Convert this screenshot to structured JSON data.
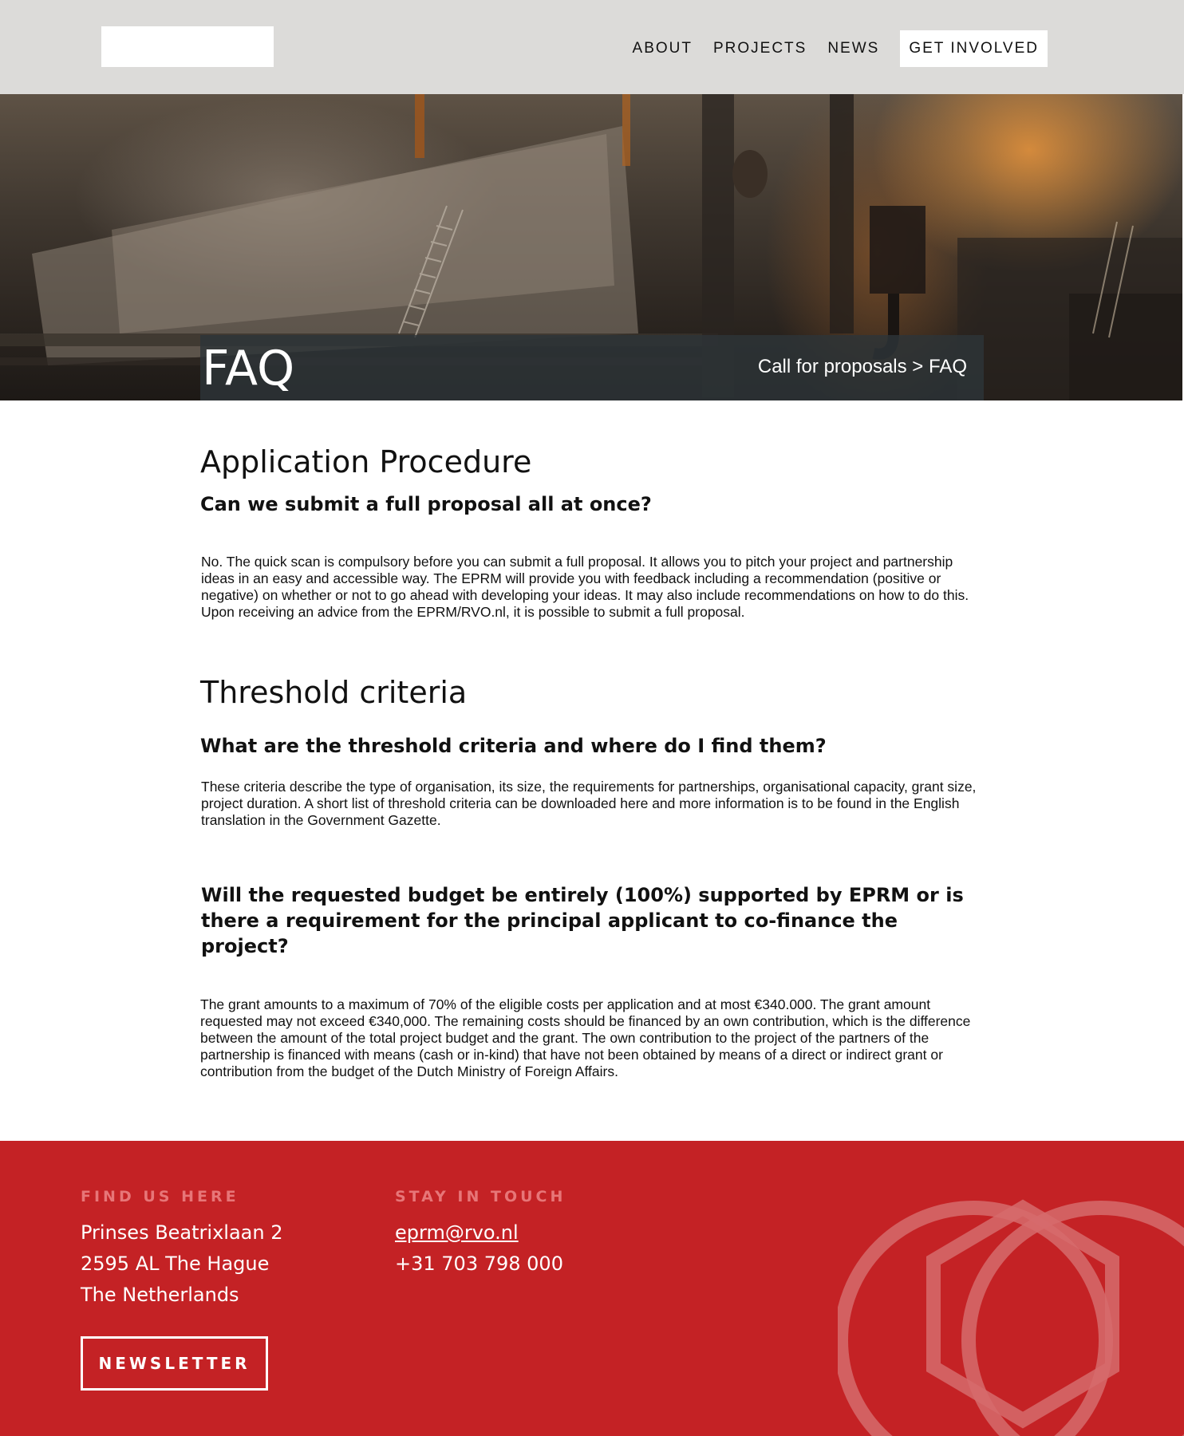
{
  "header": {
    "nav": [
      {
        "label": "ABOUT"
      },
      {
        "label": "PROJECTS"
      },
      {
        "label": "NEWS"
      },
      {
        "label": "GET INVOLVED"
      }
    ]
  },
  "hero": {
    "title": "FAQ",
    "breadcrumb": "Call for proposals > FAQ"
  },
  "sections": [
    {
      "heading": "Application Procedure",
      "question": "Can we submit a full proposal all at once?",
      "answer": "No. The quick scan is compulsory before you can submit a full proposal. It allows you to pitch your project and partnership ideas in an easy and accessible way. The EPRM will provide you with feedback including a recommendation (positive or negative) on whether or not to go ahead with developing your ideas. It may also include recommendations on how to do this. Upon receiving an advice from the EPRM/RVO.nl, it is possible to submit a full proposal."
    },
    {
      "heading": "Threshold criteria",
      "question": "What are the threshold criteria and where do I find them?",
      "answer": "These criteria describe the type of organisation, its size, the requirements for partnerships, organisational capacity, grant size, project duration. A short list of threshold criteria can be downloaded here and more information is to be found in the English translation in the Government Gazette."
    },
    {
      "question": "Will the requested budget be entirely (100%) supported by EPRM or is there a requirement for the principal applicant to co-finance the project?",
      "answer": "The grant amounts to a maximum of 70% of the eligible costs per application and at most €340.000. The grant amount requested may not exceed €340,000. The remaining costs should be financed by an own contribution, which is the difference between the amount of the total project budget and the grant. The own contribution to the project of the partners of the partnership is financed with means (cash or in-kind) that have not been obtained by means of a direct or indirect grant or contribution from the budget of the Dutch Ministry of Foreign Affairs."
    }
  ],
  "footer": {
    "find_us": {
      "title": "FIND US HERE",
      "lines": [
        "Prinses Beatrixlaan 2",
        "2595 AL The Hague",
        "The Netherlands"
      ]
    },
    "stay_in_touch": {
      "title": "STAY IN TOUCH",
      "email": "eprm@rvo.nl",
      "phone": "+31 703 798 000"
    },
    "newsletter_label": "NEWSLETTER"
  },
  "colors": {
    "header_bg": "#dcdbd9",
    "footer_bg": "#c42225",
    "footer_title": "#e77678"
  }
}
